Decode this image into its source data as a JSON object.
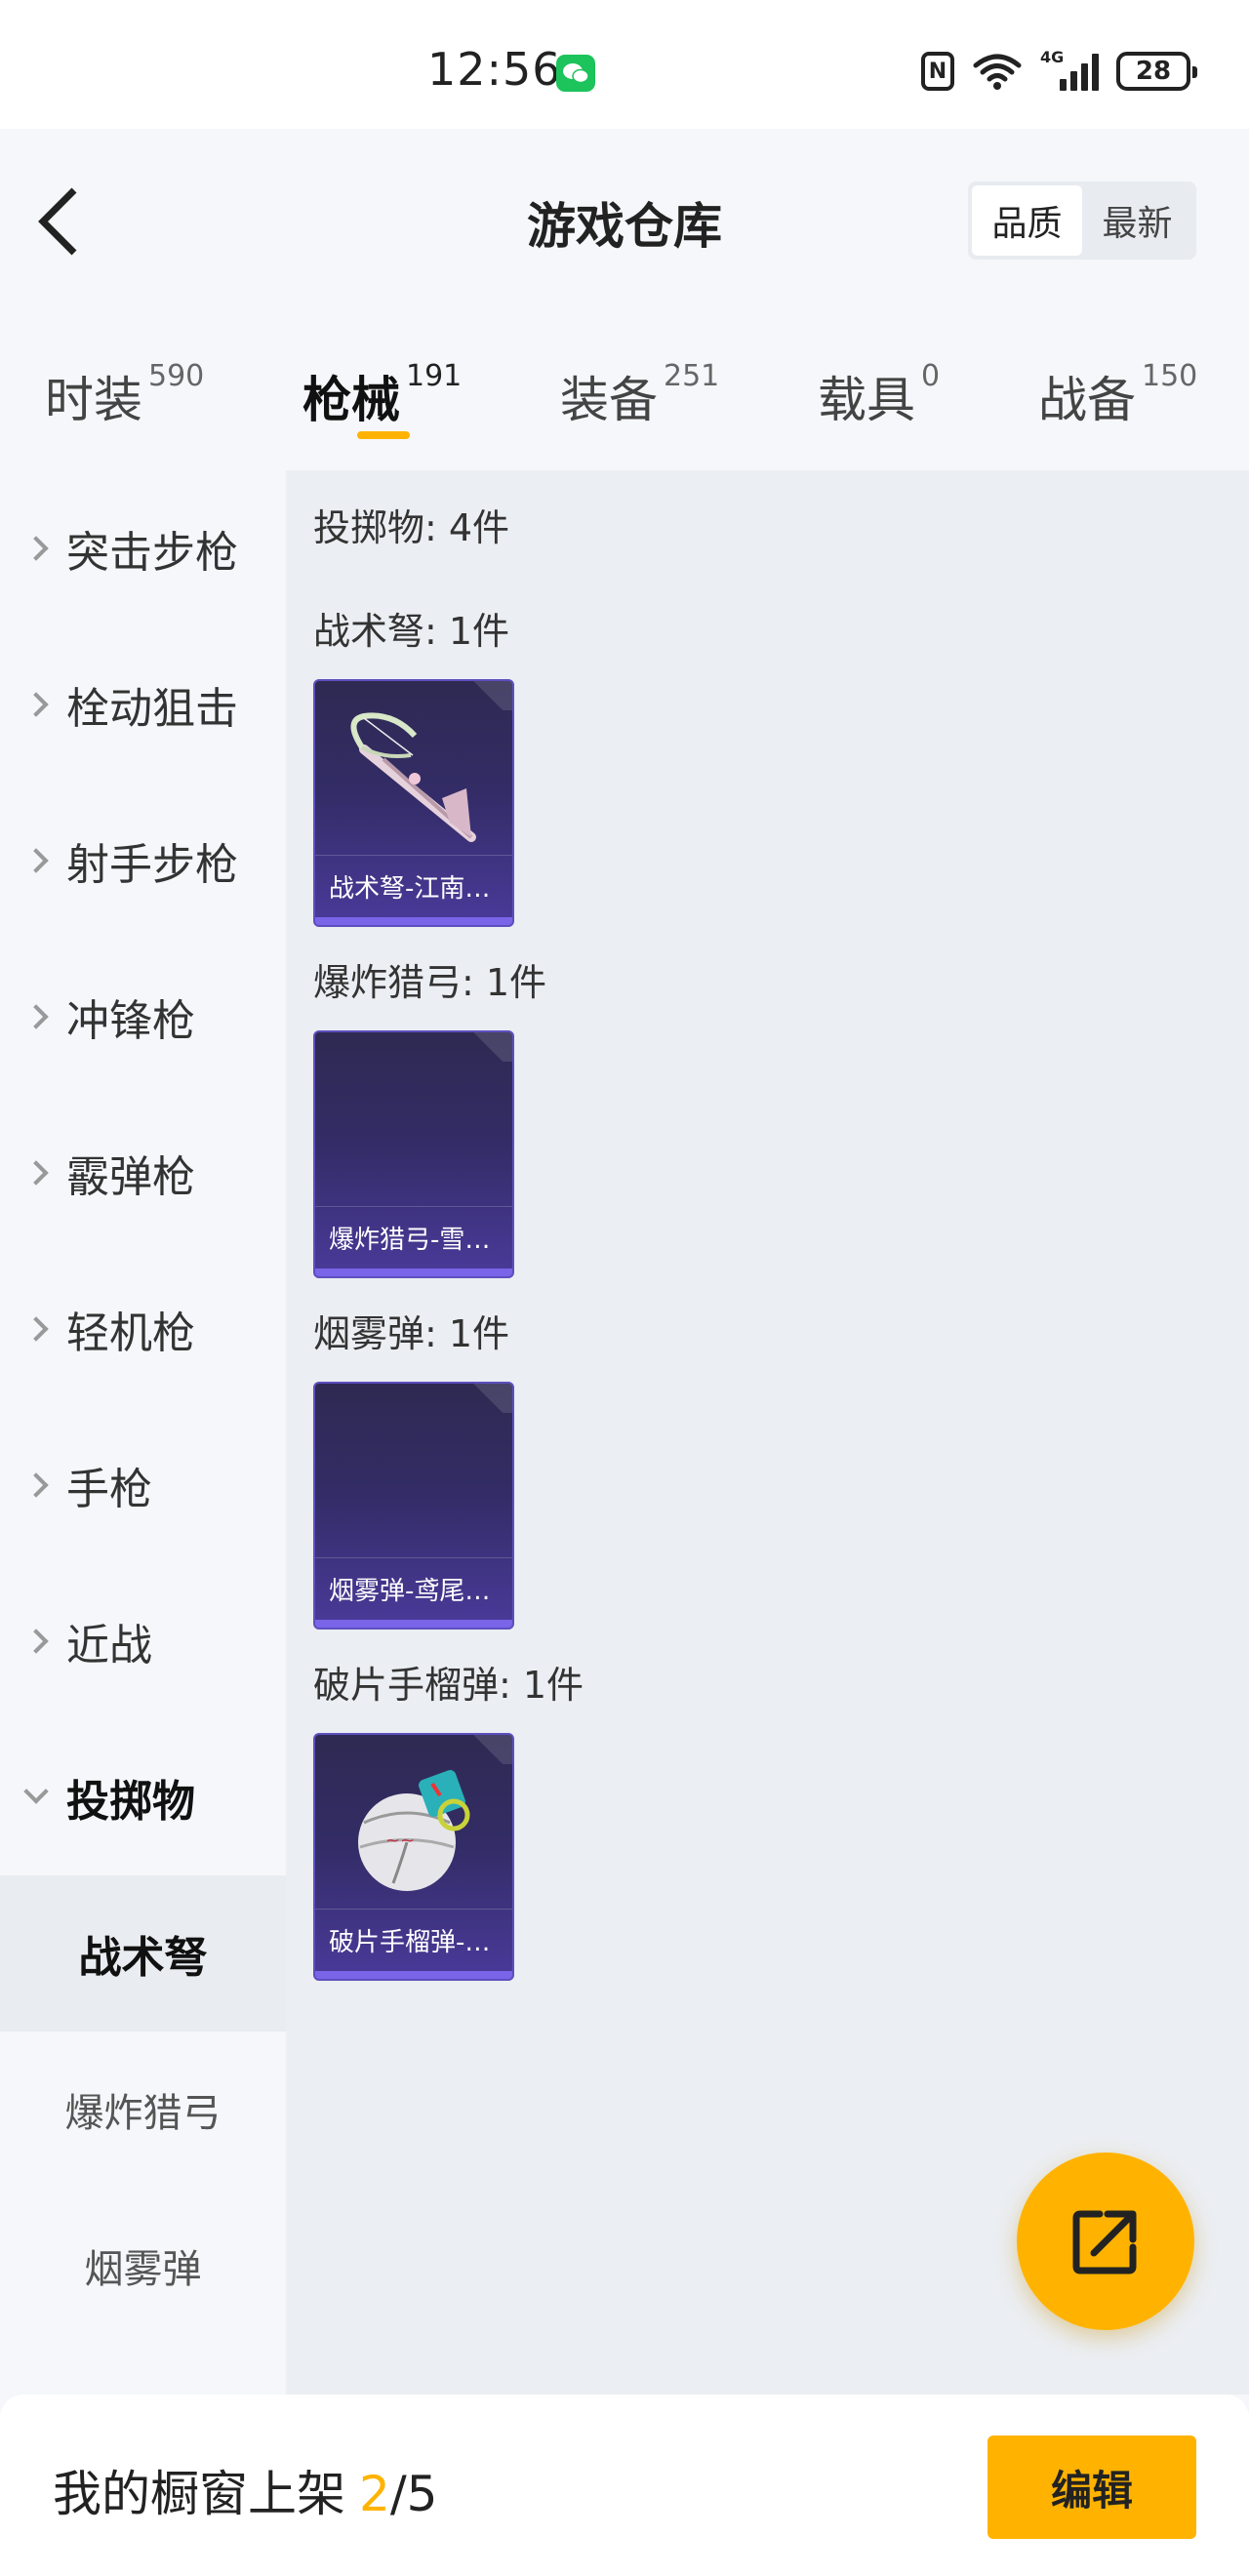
{
  "status_bar": {
    "time": "12:56",
    "network_label": "4G",
    "battery": "28"
  },
  "header": {
    "title": "游戏仓库",
    "sort_options": [
      "品质",
      "最新"
    ],
    "sort_active": "品质"
  },
  "tabs": [
    {
      "label": "时装",
      "count": "590"
    },
    {
      "label": "枪械",
      "count": "191",
      "active": true
    },
    {
      "label": "装备",
      "count": "251"
    },
    {
      "label": "载具",
      "count": "0"
    },
    {
      "label": "战备",
      "count": "150"
    }
  ],
  "sidebar": {
    "items": [
      {
        "label": "突击步枪"
      },
      {
        "label": "栓动狙击"
      },
      {
        "label": "射手步枪"
      },
      {
        "label": "冲锋枪"
      },
      {
        "label": "霰弹枪"
      },
      {
        "label": "轻机枪"
      },
      {
        "label": "手枪"
      },
      {
        "label": "近战"
      },
      {
        "label": "投掷物",
        "expanded": true
      }
    ],
    "sub_items": [
      {
        "label": "战术弩",
        "active": true
      },
      {
        "label": "爆炸猎弓"
      },
      {
        "label": "烟雾弹"
      }
    ]
  },
  "content": {
    "summary": "投掷物: 4件",
    "sections": [
      {
        "title": "战术弩: 1件",
        "item_name": "战术弩-江南…",
        "icon": "crossbow-icon"
      },
      {
        "title": "爆炸猎弓: 1件",
        "item_name": "爆炸猎弓-雪…",
        "icon": ""
      },
      {
        "title": "烟雾弹: 1件",
        "item_name": "烟雾弹-鸢尾…",
        "icon": ""
      },
      {
        "title": "破片手榴弹: 1件",
        "item_name": "破片手榴弹-…",
        "icon": "grenade-icon"
      }
    ]
  },
  "fab": {
    "icon": "share-external-icon"
  },
  "bottom_bar": {
    "label": "我的橱窗上架",
    "current": "2",
    "total": "/5",
    "edit_label": "编辑"
  },
  "colors": {
    "accent": "#ffb300",
    "card_top": "#2e2a52",
    "card_bottom": "#4a3a9a",
    "card_bar": "#7a64e8"
  }
}
